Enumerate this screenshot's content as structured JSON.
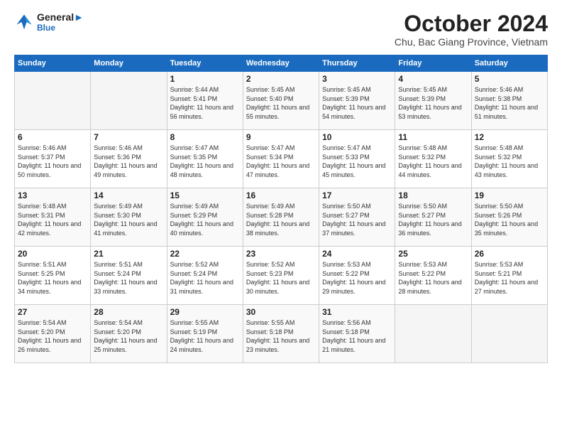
{
  "header": {
    "logo_line1": "General",
    "logo_line2": "Blue",
    "month": "October 2024",
    "location": "Chu, Bac Giang Province, Vietnam"
  },
  "days_of_week": [
    "Sunday",
    "Monday",
    "Tuesday",
    "Wednesday",
    "Thursday",
    "Friday",
    "Saturday"
  ],
  "weeks": [
    [
      {
        "day": "",
        "sunrise": "",
        "sunset": "",
        "daylight": ""
      },
      {
        "day": "",
        "sunrise": "",
        "sunset": "",
        "daylight": ""
      },
      {
        "day": "1",
        "sunrise": "Sunrise: 5:44 AM",
        "sunset": "Sunset: 5:41 PM",
        "daylight": "Daylight: 11 hours and 56 minutes."
      },
      {
        "day": "2",
        "sunrise": "Sunrise: 5:45 AM",
        "sunset": "Sunset: 5:40 PM",
        "daylight": "Daylight: 11 hours and 55 minutes."
      },
      {
        "day": "3",
        "sunrise": "Sunrise: 5:45 AM",
        "sunset": "Sunset: 5:39 PM",
        "daylight": "Daylight: 11 hours and 54 minutes."
      },
      {
        "day": "4",
        "sunrise": "Sunrise: 5:45 AM",
        "sunset": "Sunset: 5:39 PM",
        "daylight": "Daylight: 11 hours and 53 minutes."
      },
      {
        "day": "5",
        "sunrise": "Sunrise: 5:46 AM",
        "sunset": "Sunset: 5:38 PM",
        "daylight": "Daylight: 11 hours and 51 minutes."
      }
    ],
    [
      {
        "day": "6",
        "sunrise": "Sunrise: 5:46 AM",
        "sunset": "Sunset: 5:37 PM",
        "daylight": "Daylight: 11 hours and 50 minutes."
      },
      {
        "day": "7",
        "sunrise": "Sunrise: 5:46 AM",
        "sunset": "Sunset: 5:36 PM",
        "daylight": "Daylight: 11 hours and 49 minutes."
      },
      {
        "day": "8",
        "sunrise": "Sunrise: 5:47 AM",
        "sunset": "Sunset: 5:35 PM",
        "daylight": "Daylight: 11 hours and 48 minutes."
      },
      {
        "day": "9",
        "sunrise": "Sunrise: 5:47 AM",
        "sunset": "Sunset: 5:34 PM",
        "daylight": "Daylight: 11 hours and 47 minutes."
      },
      {
        "day": "10",
        "sunrise": "Sunrise: 5:47 AM",
        "sunset": "Sunset: 5:33 PM",
        "daylight": "Daylight: 11 hours and 45 minutes."
      },
      {
        "day": "11",
        "sunrise": "Sunrise: 5:48 AM",
        "sunset": "Sunset: 5:32 PM",
        "daylight": "Daylight: 11 hours and 44 minutes."
      },
      {
        "day": "12",
        "sunrise": "Sunrise: 5:48 AM",
        "sunset": "Sunset: 5:32 PM",
        "daylight": "Daylight: 11 hours and 43 minutes."
      }
    ],
    [
      {
        "day": "13",
        "sunrise": "Sunrise: 5:48 AM",
        "sunset": "Sunset: 5:31 PM",
        "daylight": "Daylight: 11 hours and 42 minutes."
      },
      {
        "day": "14",
        "sunrise": "Sunrise: 5:49 AM",
        "sunset": "Sunset: 5:30 PM",
        "daylight": "Daylight: 11 hours and 41 minutes."
      },
      {
        "day": "15",
        "sunrise": "Sunrise: 5:49 AM",
        "sunset": "Sunset: 5:29 PM",
        "daylight": "Daylight: 11 hours and 40 minutes."
      },
      {
        "day": "16",
        "sunrise": "Sunrise: 5:49 AM",
        "sunset": "Sunset: 5:28 PM",
        "daylight": "Daylight: 11 hours and 38 minutes."
      },
      {
        "day": "17",
        "sunrise": "Sunrise: 5:50 AM",
        "sunset": "Sunset: 5:27 PM",
        "daylight": "Daylight: 11 hours and 37 minutes."
      },
      {
        "day": "18",
        "sunrise": "Sunrise: 5:50 AM",
        "sunset": "Sunset: 5:27 PM",
        "daylight": "Daylight: 11 hours and 36 minutes."
      },
      {
        "day": "19",
        "sunrise": "Sunrise: 5:50 AM",
        "sunset": "Sunset: 5:26 PM",
        "daylight": "Daylight: 11 hours and 35 minutes."
      }
    ],
    [
      {
        "day": "20",
        "sunrise": "Sunrise: 5:51 AM",
        "sunset": "Sunset: 5:25 PM",
        "daylight": "Daylight: 11 hours and 34 minutes."
      },
      {
        "day": "21",
        "sunrise": "Sunrise: 5:51 AM",
        "sunset": "Sunset: 5:24 PM",
        "daylight": "Daylight: 11 hours and 33 minutes."
      },
      {
        "day": "22",
        "sunrise": "Sunrise: 5:52 AM",
        "sunset": "Sunset: 5:24 PM",
        "daylight": "Daylight: 11 hours and 31 minutes."
      },
      {
        "day": "23",
        "sunrise": "Sunrise: 5:52 AM",
        "sunset": "Sunset: 5:23 PM",
        "daylight": "Daylight: 11 hours and 30 minutes."
      },
      {
        "day": "24",
        "sunrise": "Sunrise: 5:53 AM",
        "sunset": "Sunset: 5:22 PM",
        "daylight": "Daylight: 11 hours and 29 minutes."
      },
      {
        "day": "25",
        "sunrise": "Sunrise: 5:53 AM",
        "sunset": "Sunset: 5:22 PM",
        "daylight": "Daylight: 11 hours and 28 minutes."
      },
      {
        "day": "26",
        "sunrise": "Sunrise: 5:53 AM",
        "sunset": "Sunset: 5:21 PM",
        "daylight": "Daylight: 11 hours and 27 minutes."
      }
    ],
    [
      {
        "day": "27",
        "sunrise": "Sunrise: 5:54 AM",
        "sunset": "Sunset: 5:20 PM",
        "daylight": "Daylight: 11 hours and 26 minutes."
      },
      {
        "day": "28",
        "sunrise": "Sunrise: 5:54 AM",
        "sunset": "Sunset: 5:20 PM",
        "daylight": "Daylight: 11 hours and 25 minutes."
      },
      {
        "day": "29",
        "sunrise": "Sunrise: 5:55 AM",
        "sunset": "Sunset: 5:19 PM",
        "daylight": "Daylight: 11 hours and 24 minutes."
      },
      {
        "day": "30",
        "sunrise": "Sunrise: 5:55 AM",
        "sunset": "Sunset: 5:18 PM",
        "daylight": "Daylight: 11 hours and 23 minutes."
      },
      {
        "day": "31",
        "sunrise": "Sunrise: 5:56 AM",
        "sunset": "Sunset: 5:18 PM",
        "daylight": "Daylight: 11 hours and 21 minutes."
      },
      {
        "day": "",
        "sunrise": "",
        "sunset": "",
        "daylight": ""
      },
      {
        "day": "",
        "sunrise": "",
        "sunset": "",
        "daylight": ""
      }
    ]
  ]
}
